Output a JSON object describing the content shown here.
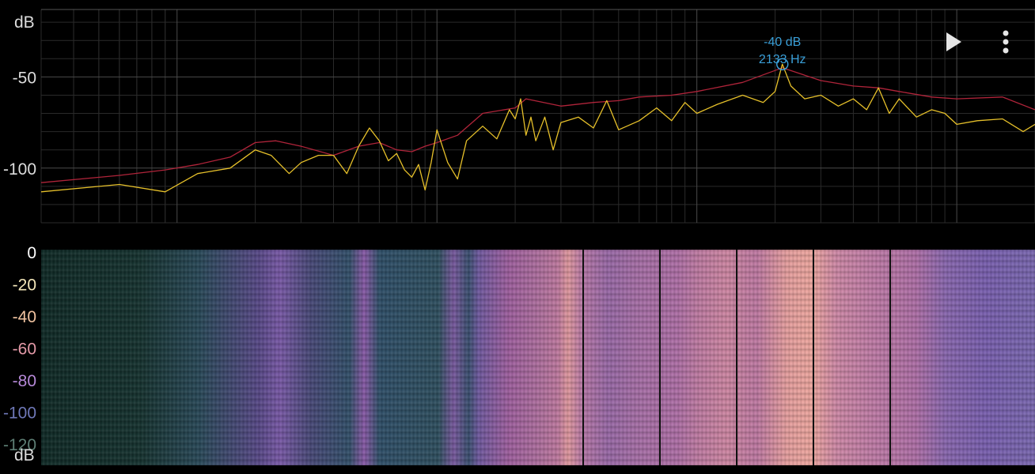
{
  "spectrum": {
    "y_unit": "dB",
    "x_unit": "Hz",
    "y_ticks": [
      "-50",
      "-100"
    ],
    "x_ticks": [
      "10",
      "100",
      "1000",
      "10000"
    ],
    "peak": {
      "db_label": "-40 dB",
      "hz_label": "2133 Hz",
      "marker_label": "2133"
    }
  },
  "waterfall": {
    "y_ticks": [
      "0",
      "-20",
      "-40",
      "-60",
      "-80",
      "-100",
      "-120"
    ],
    "y_tick_colors": [
      "#ffffff",
      "#f3e6b8",
      "#f1c3a0",
      "#e49aa8",
      "#b689d8",
      "#6f78b8",
      "#5d7e74"
    ],
    "y_unit": "dB"
  },
  "controls": {
    "play_icon": "play-icon",
    "menu_icon": "more-vert-icon"
  },
  "chart_data": {
    "type": "line",
    "xscale": "log",
    "xlim": [
      3,
      20000
    ],
    "ylim": [
      -130,
      -13
    ],
    "xlabel": "Hz",
    "ylabel": "dB",
    "grid": true,
    "series": [
      {
        "color": "#b0243a",
        "x": [
          3,
          6,
          9,
          12,
          16,
          20,
          24,
          30,
          40,
          50,
          60,
          70,
          80,
          90,
          100,
          120,
          150,
          200,
          220,
          300,
          400,
          500,
          600,
          800,
          1000,
          1500,
          2133,
          3000,
          4000,
          5000,
          6000,
          8000,
          10000,
          15000,
          20000
        ],
        "y": [
          -108,
          -104,
          -101,
          -98,
          -94,
          -86,
          -85,
          -88,
          -93,
          -88,
          -86,
          -90,
          -91,
          -88,
          -86,
          -82,
          -70,
          -67,
          -62,
          -66,
          -64,
          -63,
          -61,
          -60,
          -58,
          -53,
          -45,
          -52,
          -55,
          -56,
          -58,
          -61,
          -62,
          -61,
          -68
        ]
      },
      {
        "color": "#e6c02a",
        "x": [
          3,
          6,
          9,
          12,
          16,
          20,
          23,
          27,
          30,
          35,
          40,
          45,
          50,
          55,
          60,
          65,
          70,
          75,
          80,
          85,
          90,
          95,
          100,
          110,
          120,
          130,
          150,
          170,
          190,
          200,
          210,
          220,
          230,
          240,
          260,
          280,
          300,
          350,
          400,
          450,
          500,
          600,
          700,
          800,
          900,
          1000,
          1200,
          1500,
          1800,
          2000,
          2133,
          2300,
          2600,
          3000,
          3500,
          4000,
          4500,
          5000,
          5500,
          6000,
          7000,
          8000,
          9000,
          10000,
          12000,
          15000,
          18000,
          20000
        ],
        "y": [
          -113,
          -109,
          -113,
          -103,
          -100,
          -90,
          -93,
          -103,
          -97,
          -93,
          -93,
          -103,
          -88,
          -78,
          -85,
          -96,
          -92,
          -101,
          -105,
          -98,
          -112,
          -97,
          -79,
          -97,
          -106,
          -85,
          -77,
          -84,
          -68,
          -73,
          -62,
          -82,
          -72,
          -85,
          -72,
          -90,
          -75,
          -72,
          -78,
          -63,
          -79,
          -74,
          -67,
          -74,
          -64,
          -70,
          -65,
          -60,
          -64,
          -58,
          -43,
          -55,
          -62,
          -60,
          -66,
          -62,
          -68,
          -56,
          -70,
          -62,
          -72,
          -68,
          -70,
          -76,
          -74,
          -73,
          -80,
          -76
        ]
      }
    ]
  }
}
